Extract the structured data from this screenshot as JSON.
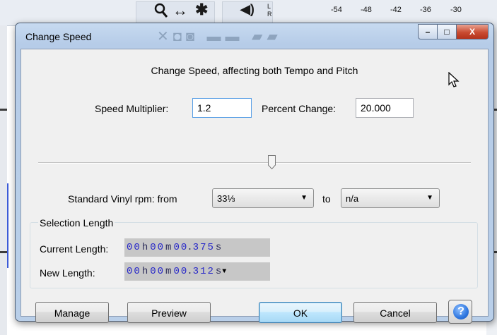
{
  "background": {
    "ruler_ticks": [
      "-54",
      "-48",
      "-42",
      "-36",
      "-30"
    ],
    "lr_labels": [
      "L",
      "R"
    ],
    "tools": [
      "search-icon",
      "arrows-icon",
      "asterisk-icon",
      "speaker-icon"
    ]
  },
  "dialog": {
    "title": "Change Speed",
    "window_buttons": {
      "minimize": "–",
      "maximize": "□",
      "close": "X"
    },
    "heading": "Change Speed, affecting both Tempo and Pitch",
    "speed_multiplier": {
      "label": "Speed Multiplier:",
      "value": "1.2"
    },
    "percent_change": {
      "label": "Percent Change:",
      "value": "20.000"
    },
    "slider": {
      "value_fraction": 0.54
    },
    "vinyl": {
      "label": "Standard Vinyl rpm:  from",
      "from_value": "33⅓",
      "to_label": "to",
      "to_value": "n/a"
    },
    "selection": {
      "group_title": "Selection Length",
      "current_label": "Current Length:",
      "current_value": [
        "0",
        "0",
        "h",
        "0",
        "0",
        "m",
        "0",
        "0",
        ".",
        "3",
        "7",
        "5",
        "s"
      ],
      "new_label": "New Length:",
      "new_value": [
        "0",
        "0",
        "h",
        "0",
        "0",
        "m",
        "0",
        "0",
        ".",
        "3",
        "1",
        "2",
        "s"
      ]
    },
    "buttons": {
      "manage": "Manage",
      "preview": "Preview",
      "ok": "OK",
      "cancel": "Cancel",
      "help": "?"
    }
  },
  "colors": {
    "title_bar": "#b9cfe9",
    "client_bg": "#f0f0f0",
    "time_digits": "#2727c8",
    "close_button": "#c94b31",
    "ok_button": "#bee6fd"
  }
}
